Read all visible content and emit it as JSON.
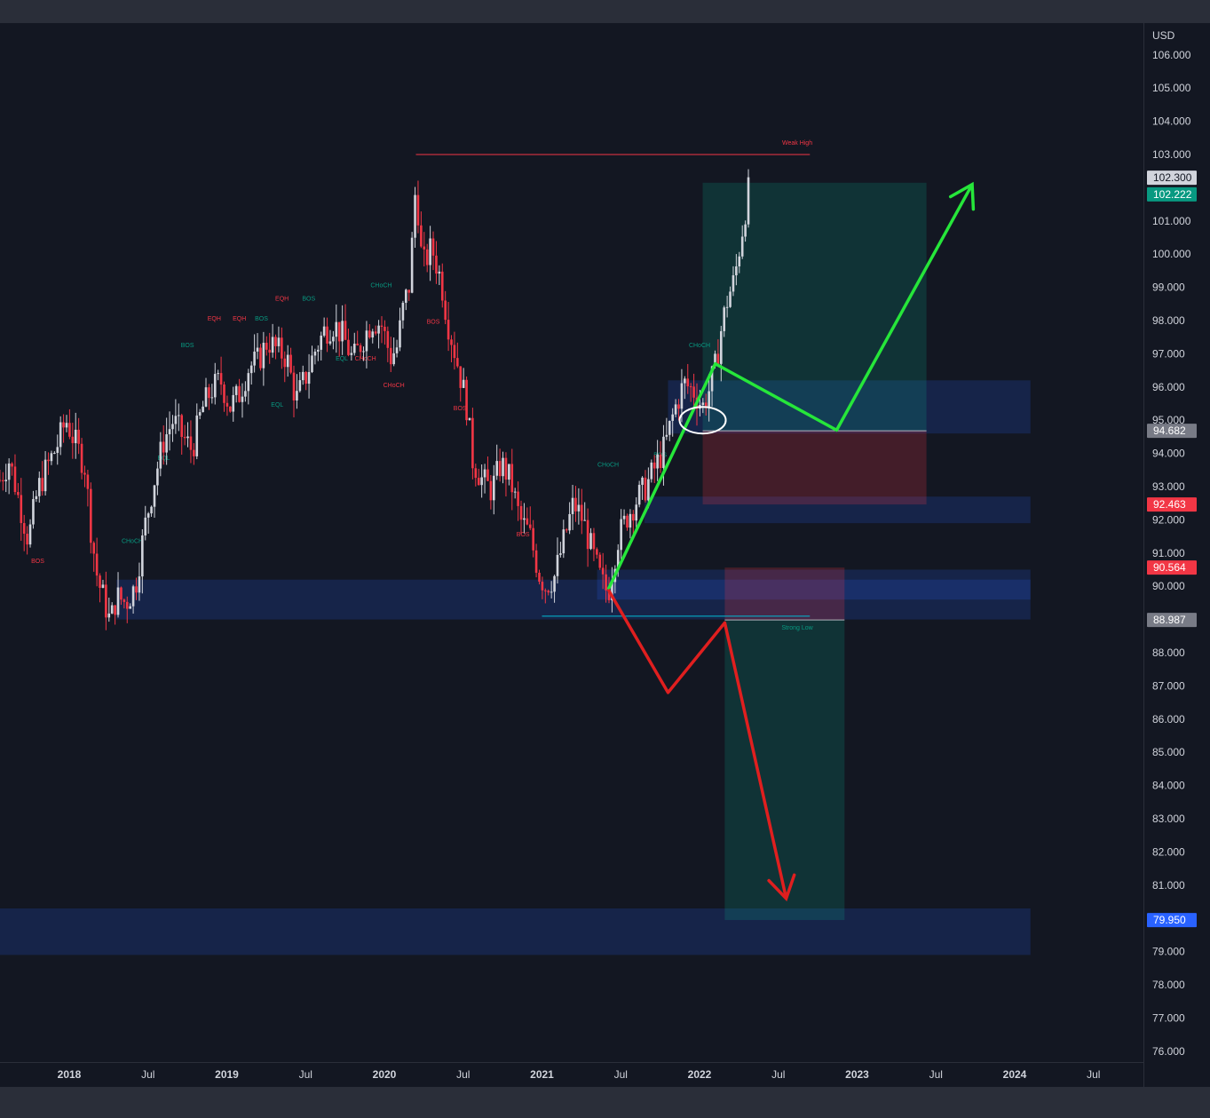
{
  "chart_data": {
    "type": "candlestick",
    "currency": "USD",
    "y_axis": {
      "range": [
        75.3,
        107.1
      ],
      "ticks": [
        "106.000",
        "105.000",
        "104.000",
        "103.000",
        "101.000",
        "100.000",
        "99.000",
        "98.000",
        "97.000",
        "96.000",
        "95.000",
        "94.000",
        "93.000",
        "92.000",
        "91.000",
        "90.000",
        "88.000",
        "87.000",
        "86.000",
        "85.000",
        "84.000",
        "83.000",
        "82.000",
        "81.000",
        "79.000",
        "78.000",
        "77.000",
        "76.000"
      ]
    },
    "x_axis": {
      "ticks": [
        {
          "label": "2018",
          "bold": true,
          "t": 2018.0
        },
        {
          "label": "Jul",
          "bold": false,
          "t": 2018.5
        },
        {
          "label": "2019",
          "bold": true,
          "t": 2019.0
        },
        {
          "label": "Jul",
          "bold": false,
          "t": 2019.5
        },
        {
          "label": "2020",
          "bold": true,
          "t": 2020.0
        },
        {
          "label": "Jul",
          "bold": false,
          "t": 2020.5
        },
        {
          "label": "2021",
          "bold": true,
          "t": 2021.0
        },
        {
          "label": "Jul",
          "bold": false,
          "t": 2021.5
        },
        {
          "label": "2022",
          "bold": true,
          "t": 2022.0
        },
        {
          "label": "Jul",
          "bold": false,
          "t": 2022.5
        },
        {
          "label": "2023",
          "bold": true,
          "t": 2023.0
        },
        {
          "label": "Jul",
          "bold": false,
          "t": 2023.5
        },
        {
          "label": "2024",
          "bold": true,
          "t": 2024.0
        },
        {
          "label": "Jul",
          "bold": false,
          "t": 2024.5
        }
      ]
    },
    "close_path": [
      [
        2017.56,
        93.2
      ],
      [
        2017.62,
        93.8
      ],
      [
        2017.68,
        92.6
      ],
      [
        2017.74,
        91.4
      ],
      [
        2017.8,
        92.9
      ],
      [
        2017.86,
        93.6
      ],
      [
        2017.92,
        94.2
      ],
      [
        2017.98,
        95.0
      ],
      [
        2018.04,
        94.3
      ],
      [
        2018.1,
        93.6
      ],
      [
        2018.14,
        91.6
      ],
      [
        2018.18,
        90.2
      ],
      [
        2018.22,
        89.6
      ],
      [
        2018.26,
        88.9
      ],
      [
        2018.3,
        89.7
      ],
      [
        2018.36,
        89.5
      ],
      [
        2018.42,
        90.0
      ],
      [
        2018.48,
        91.8
      ],
      [
        2018.54,
        93.2
      ],
      [
        2018.6,
        94.4
      ],
      [
        2018.66,
        95.0
      ],
      [
        2018.72,
        94.5
      ],
      [
        2018.78,
        94.1
      ],
      [
        2018.84,
        95.3
      ],
      [
        2018.9,
        95.9
      ],
      [
        2018.96,
        96.2
      ],
      [
        2019.02,
        95.4
      ],
      [
        2019.08,
        95.8
      ],
      [
        2019.14,
        96.6
      ],
      [
        2019.2,
        96.8
      ],
      [
        2019.26,
        97.4
      ],
      [
        2019.32,
        97.1
      ],
      [
        2019.38,
        96.9
      ],
      [
        2019.44,
        95.6
      ],
      [
        2019.5,
        96.3
      ],
      [
        2019.56,
        97.1
      ],
      [
        2019.62,
        97.7
      ],
      [
        2019.68,
        97.9
      ],
      [
        2019.74,
        97.5
      ],
      [
        2019.8,
        96.8
      ],
      [
        2019.86,
        97.4
      ],
      [
        2019.92,
        98.0
      ],
      [
        2019.98,
        97.9
      ],
      [
        2020.04,
        96.9
      ],
      [
        2020.08,
        97.2
      ],
      [
        2020.12,
        98.4
      ],
      [
        2020.16,
        99.1
      ],
      [
        2020.2,
        102.2
      ],
      [
        2020.24,
        99.6
      ],
      [
        2020.3,
        100.2
      ],
      [
        2020.36,
        99.2
      ],
      [
        2020.4,
        98.0
      ],
      [
        2020.46,
        96.8
      ],
      [
        2020.52,
        95.5
      ],
      [
        2020.56,
        93.8
      ],
      [
        2020.62,
        93.2
      ],
      [
        2020.68,
        92.9
      ],
      [
        2020.74,
        93.7
      ],
      [
        2020.8,
        93.2
      ],
      [
        2020.86,
        92.0
      ],
      [
        2020.92,
        91.6
      ],
      [
        2020.98,
        90.4
      ],
      [
        2021.02,
        90.0
      ],
      [
        2021.08,
        90.3
      ],
      [
        2021.14,
        91.4
      ],
      [
        2021.2,
        92.5
      ],
      [
        2021.26,
        92.0
      ],
      [
        2021.32,
        91.0
      ],
      [
        2021.38,
        90.1
      ],
      [
        2021.42,
        89.8
      ],
      [
        2021.48,
        91.4
      ],
      [
        2021.54,
        92.1
      ],
      [
        2021.6,
        92.6
      ],
      [
        2021.66,
        93.0
      ],
      [
        2021.72,
        93.6
      ],
      [
        2021.78,
        94.2
      ],
      [
        2021.84,
        95.3
      ],
      [
        2021.9,
        96.1
      ],
      [
        2021.96,
        95.9
      ],
      [
        2022.02,
        95.4
      ],
      [
        2022.06,
        95.9
      ],
      [
        2022.1,
        96.6
      ],
      [
        2022.14,
        97.8
      ],
      [
        2022.18,
        98.7
      ],
      [
        2022.22,
        99.2
      ],
      [
        2022.26,
        100.4
      ],
      [
        2022.3,
        101.6
      ],
      [
        2022.32,
        102.2
      ]
    ],
    "current_price": "102.222",
    "price_labels": [
      {
        "value": "102.300",
        "price": 102.3,
        "bg": "#d1d4dc",
        "fg": "#131722"
      },
      {
        "value": "102.222",
        "price": 101.8,
        "bg": "#089981",
        "fg": "#ffffff"
      },
      {
        "value": "94.682",
        "price": 94.682,
        "bg": "#787b86",
        "fg": "#ffffff"
      },
      {
        "value": "92.463",
        "price": 92.463,
        "bg": "#f23645",
        "fg": "#ffffff"
      },
      {
        "value": "90.564",
        "price": 90.564,
        "bg": "#f23645",
        "fg": "#ffffff"
      },
      {
        "value": "88.987",
        "price": 88.987,
        "bg": "#787b86",
        "fg": "#ffffff"
      },
      {
        "value": "79.950",
        "price": 79.95,
        "bg": "#2962ff",
        "fg": "#ffffff"
      }
    ],
    "zones": [
      {
        "t1": 2018.3,
        "t2": 2024.1,
        "p1": 90.2,
        "p2": 89.0
      },
      {
        "t1": 2021.35,
        "t2": 2024.1,
        "p1": 90.5,
        "p2": 89.6
      },
      {
        "t1": 2021.8,
        "t2": 2024.1,
        "p1": 96.2,
        "p2": 94.6
      },
      {
        "t1": 2021.65,
        "t2": 2024.1,
        "p1": 92.7,
        "p2": 91.9
      },
      {
        "t1": 2017.56,
        "t2": 2024.1,
        "p1": 80.3,
        "p2": 78.9
      }
    ],
    "long_position": {
      "t1": 2022.02,
      "t2": 2023.44,
      "entry": 94.682,
      "target": 102.15,
      "stop": 92.463
    },
    "short_position": {
      "t1": 2022.16,
      "t2": 2022.92,
      "entry": 88.987,
      "target": 79.95,
      "stop": 90.564
    },
    "structure_lines": [
      {
        "kind": "strong-low",
        "t1": 2021.0,
        "t2": 2022.7,
        "price": 89.1,
        "color": "#00bcd4"
      },
      {
        "kind": "weak-high",
        "t1": 2020.2,
        "t2": 2022.7,
        "price": 103.0,
        "color": "#f23645"
      }
    ],
    "structure_labels": [
      {
        "text": "BOS",
        "t": 2017.8,
        "price": 90.7,
        "color": "#f23645"
      },
      {
        "text": "CHoCH",
        "t": 2018.4,
        "price": 91.3,
        "color": "#089981"
      },
      {
        "text": "BOS",
        "t": 2018.75,
        "price": 97.2,
        "color": "#089981"
      },
      {
        "text": "EQL",
        "t": 2018.6,
        "price": 93.8,
        "color": "#089981"
      },
      {
        "text": "EQH",
        "t": 2018.92,
        "price": 98.0,
        "color": "#f23645"
      },
      {
        "text": "EQH",
        "t": 2019.08,
        "price": 98.0,
        "color": "#f23645"
      },
      {
        "text": "BOS",
        "t": 2019.22,
        "price": 98.0,
        "color": "#089981"
      },
      {
        "text": "EQL",
        "t": 2019.32,
        "price": 95.4,
        "color": "#089981"
      },
      {
        "text": "EQH",
        "t": 2019.35,
        "price": 98.6,
        "color": "#f23645"
      },
      {
        "text": "BOS",
        "t": 2019.52,
        "price": 98.6,
        "color": "#089981"
      },
      {
        "text": "EQL",
        "t": 2019.73,
        "price": 96.8,
        "color": "#089981"
      },
      {
        "text": "CHoCH",
        "t": 2019.88,
        "price": 96.8,
        "color": "#f23645"
      },
      {
        "text": "CHoCH",
        "t": 2019.98,
        "price": 99.0,
        "color": "#089981"
      },
      {
        "text": "CHoCH",
        "t": 2020.06,
        "price": 96.0,
        "color": "#f23645"
      },
      {
        "text": "BOS",
        "t": 2020.31,
        "price": 97.9,
        "color": "#f23645"
      },
      {
        "text": "BOS",
        "t": 2020.48,
        "price": 95.3,
        "color": "#f23645"
      },
      {
        "text": "BOS",
        "t": 2020.88,
        "price": 91.5,
        "color": "#f23645"
      },
      {
        "text": "CHoCH",
        "t": 2021.42,
        "price": 93.6,
        "color": "#089981"
      },
      {
        "text": "BOS",
        "t": 2021.75,
        "price": 93.9,
        "color": "#089981"
      },
      {
        "text": "CHoCH",
        "t": 2022.0,
        "price": 97.2,
        "color": "#089981"
      },
      {
        "text": "Weak High",
        "t": 2022.62,
        "price": 103.3,
        "color": "#f23645"
      },
      {
        "text": "Strong Low",
        "t": 2022.62,
        "price": 88.7,
        "color": "#089981"
      }
    ],
    "bull_path": [
      [
        2021.42,
        89.9
      ],
      [
        2022.1,
        96.7
      ],
      [
        2022.87,
        94.7
      ],
      [
        2023.73,
        102.1
      ]
    ],
    "bear_path": [
      [
        2021.42,
        89.9
      ],
      [
        2021.8,
        86.8
      ],
      [
        2022.16,
        88.9
      ],
      [
        2022.55,
        80.6
      ]
    ],
    "circle_annotation": {
      "t": 2022.02,
      "price": 95.0
    },
    "colors": {
      "background": "#131722",
      "up_candle": "#d1d4dc",
      "down_candle": "#f23645",
      "bull_arrow": "#26e63a",
      "bear_arrow": "#e01f1f",
      "zone_fill": "#2962ff",
      "profit_fill": "#089981",
      "loss_fill": "#f23645"
    }
  }
}
